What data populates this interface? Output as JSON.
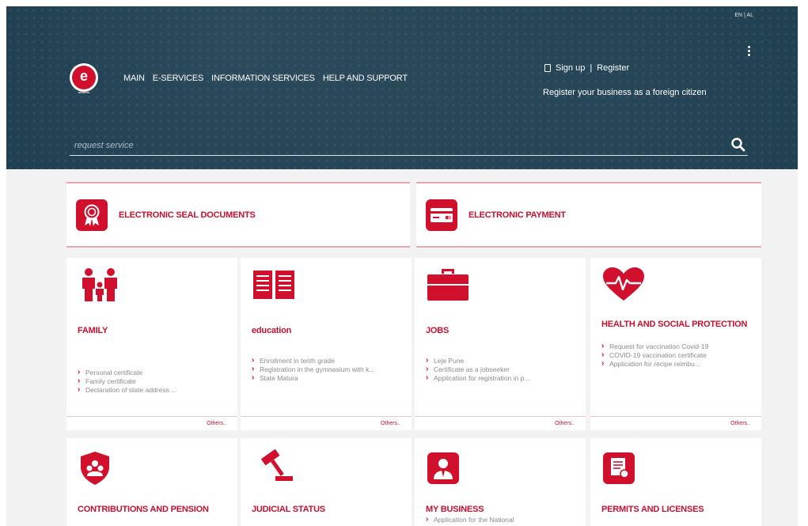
{
  "header": {
    "language": "EN | AL",
    "logo_text": "e",
    "logo_subtext": "albania",
    "nav": [
      "MAIN",
      "E-SERVICES",
      "INFORMATION SERVICES",
      "HELP AND SUPPORT"
    ],
    "signup_label": "Sign up",
    "separator": "|",
    "register_label": "Register",
    "foreign_register": "Register your business as a foreign citizen",
    "search_placeholder": "request service",
    "colors": {
      "background": "#1c3d4f",
      "accent": "#d1102e"
    }
  },
  "featured": [
    {
      "label": "ELECTRONIC SEAL DOCUMENTS",
      "icon": "seal-badge-icon"
    },
    {
      "label": "ELECTRONIC PAYMENT",
      "icon": "payment-card-icon"
    }
  ],
  "categories": [
    {
      "title": "FAMILY",
      "icon": "family-icon",
      "items": [
        "Personal certificate",
        "Family certificate",
        "Declaration of state address ..."
      ],
      "others": "Others.."
    },
    {
      "title": "education",
      "icon": "book-icon",
      "items": [
        "Enrollment in tenth grade",
        "Registration in the gymnasium with k...",
        "State Matura"
      ],
      "others": "Others.."
    },
    {
      "title": "JOBS",
      "icon": "briefcase-icon",
      "items": [
        "Leje Pune",
        "Certificate as a jobseeker",
        "Application for registration in p..."
      ],
      "others": "Others.."
    },
    {
      "title": "HEALTH AND SOCIAL PROTECTION",
      "icon": "heart-pulse-icon",
      "items": [
        "Request for vaccination Covid-19",
        "COVID-19 vaccination certificate",
        "Application for recipe reimbu..."
      ],
      "others": "Others.."
    },
    {
      "title": "CONTRIBUTIONS AND PENSION",
      "icon": "shield-people-icon",
      "items": []
    },
    {
      "title": "JUDICIAL STATUS",
      "icon": "gavel-icon",
      "items": []
    },
    {
      "title": "MY BUSINESS",
      "icon": "business-person-icon",
      "items": [
        "Application for the National"
      ]
    },
    {
      "title": "PERMITS AND LICENSES",
      "icon": "license-document-icon",
      "items": []
    }
  ]
}
